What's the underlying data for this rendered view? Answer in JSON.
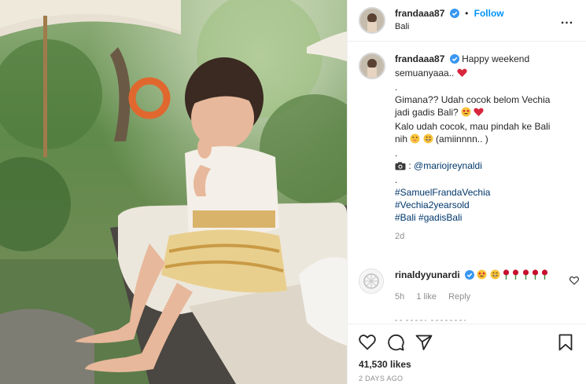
{
  "post": {
    "username": "frandaaa87",
    "separator": "•",
    "follow_label": "Follow",
    "location": "Bali",
    "more_label": "...",
    "photo_alt": "photo"
  },
  "caption": {
    "username": "frandaaa87",
    "line1": "Happy weekend",
    "line2": "semuanyaaa..",
    "dot1": ".",
    "line3": "Gimana?? Udah cocok belom Vechia",
    "line4": "jadi gadis Bali?",
    "line5": "Kalo udah cocok, mau pindah ke Bali",
    "line6_a": "nih",
    "line6_b": "(amiinnnn.. )",
    "dot2": ".",
    "credit_prefix": ": ",
    "credit_handle": "@mariojreynaldi",
    "dot3": ".",
    "tags": [
      "#SamuelFrandaVechia",
      "#Vechia2yearsold",
      "#Bali",
      "#gadisBali"
    ],
    "age": "2d"
  },
  "comment": {
    "username": "rinaldyyunardi",
    "time": "5h",
    "likes": "1 like",
    "reply": "Reply"
  },
  "actions": {
    "likes": "41,530 likes",
    "date": "2 DAYS AGO"
  },
  "colors": {
    "accent": "#0095f6",
    "verified": "#3897f0",
    "link": "#00376b",
    "muted": "#8e8e8e",
    "heart": "#ed4956"
  },
  "icons": [
    "verified-icon",
    "more-icon",
    "heart-icon",
    "comment-icon",
    "share-icon",
    "save-icon",
    "camera-icon"
  ]
}
